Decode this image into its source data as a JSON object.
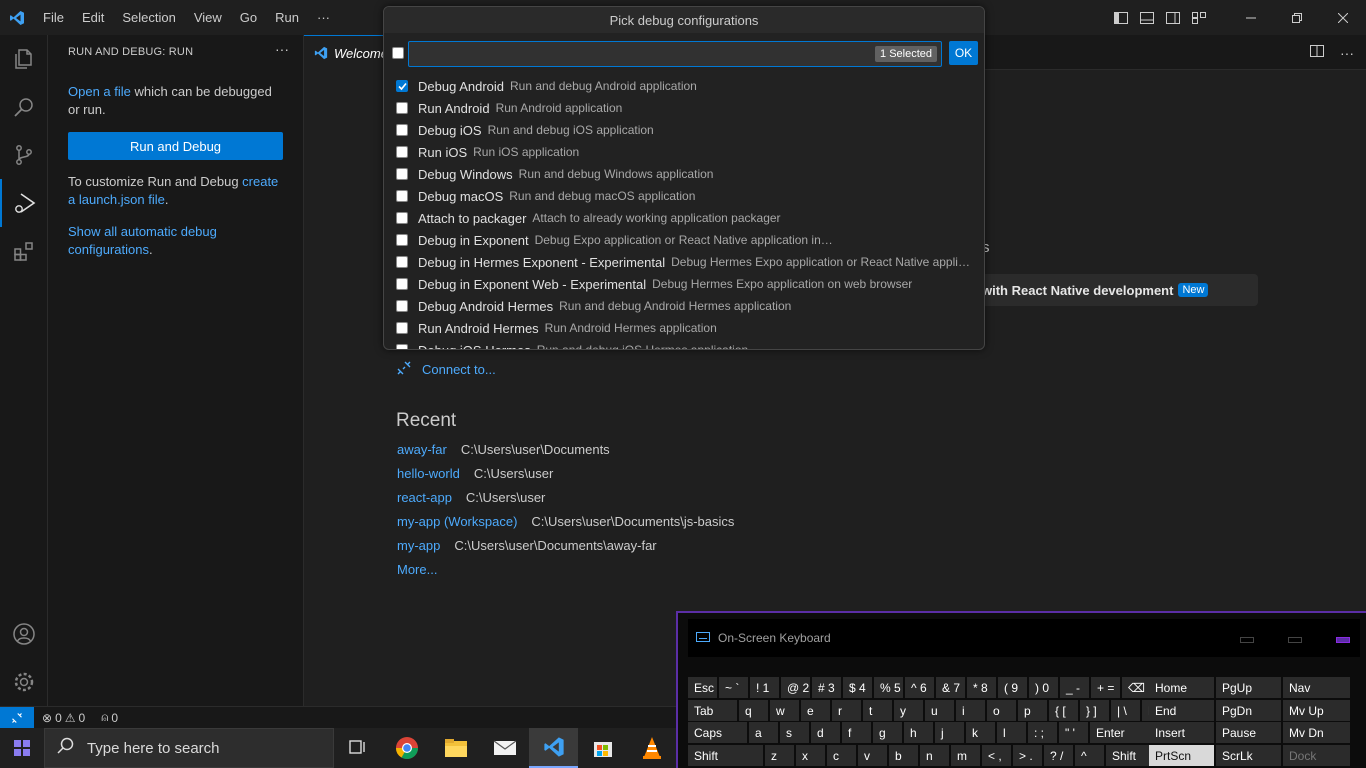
{
  "menubar": {
    "items": [
      "File",
      "Edit",
      "Selection",
      "View",
      "Go",
      "Run",
      "···"
    ]
  },
  "sidebar": {
    "title": "RUN AND DEBUG: RUN",
    "more": "···",
    "open_file_link": "Open a file",
    "open_file_rest": " which can be debugged or run.",
    "run_debug_button": "Run and Debug",
    "customize_text": "To customize Run and Debug ",
    "create_link": "create a launch.json file",
    "customize_end": ".",
    "show_all_link": "Show all automatic debug configurations",
    "show_all_end": "."
  },
  "editor": {
    "tab_label": "Welcome",
    "walkthrough_fragment": "s",
    "walkthrough_title": "with React Native development",
    "walkthrough_badge": "New",
    "connect_label": "Connect to...",
    "recent_heading": "Recent",
    "recent": [
      {
        "name": "away-far",
        "path": "C:\\Users\\user\\Documents"
      },
      {
        "name": "hello-world",
        "path": "C:\\Users\\user"
      },
      {
        "name": "react-app",
        "path": "C:\\Users\\user"
      },
      {
        "name": "my-app (Workspace)",
        "path": "C:\\Users\\user\\Documents\\js-basics"
      },
      {
        "name": "my-app",
        "path": "C:\\Users\\user\\Documents\\away-far"
      }
    ],
    "more_label": "More..."
  },
  "quickpick": {
    "title": "Pick debug configurations",
    "input_value": "",
    "selected_count": "1 Selected",
    "ok_label": "OK",
    "items": [
      {
        "label": "Debug Android",
        "desc": "Run and debug Android application",
        "checked": true
      },
      {
        "label": "Run Android",
        "desc": "Run Android application",
        "checked": false
      },
      {
        "label": "Debug iOS",
        "desc": "Run and debug iOS application",
        "checked": false
      },
      {
        "label": "Run iOS",
        "desc": "Run iOS application",
        "checked": false
      },
      {
        "label": "Debug Windows",
        "desc": "Run and debug Windows application",
        "checked": false
      },
      {
        "label": "Debug macOS",
        "desc": "Run and debug macOS application",
        "checked": false
      },
      {
        "label": "Attach to packager",
        "desc": "Attach to already working application packager",
        "checked": false
      },
      {
        "label": "Debug in Exponent",
        "desc": "Debug Expo application or React Native application in Expo",
        "checked": false
      },
      {
        "label": "Debug in Hermes Exponent - Experimental",
        "desc": "Debug Hermes Expo application or React Native applic...",
        "checked": false
      },
      {
        "label": "Debug in Exponent Web - Experimental",
        "desc": "Debug Hermes Expo application on web browser",
        "checked": false
      },
      {
        "label": "Debug Android Hermes",
        "desc": "Run and debug Android Hermes application",
        "checked": false
      },
      {
        "label": "Run Android Hermes",
        "desc": "Run Android Hermes application",
        "checked": false
      },
      {
        "label": "Debug iOS Hermes",
        "desc": "Run and debug iOS Hermes application",
        "checked": false
      }
    ]
  },
  "statusbar": {
    "errors": "0",
    "warnings": "0",
    "ports": "0"
  },
  "osk": {
    "title": "On-Screen Keyboard",
    "row1": [
      "Esc",
      "~ `",
      "! 1",
      "@ 2",
      "# 3",
      "$ 4",
      "% 5",
      "^ 6",
      "& 7",
      "* 8",
      "( 9",
      ") 0",
      "_ -",
      "+ =",
      "⌫",
      "Home",
      "PgUp",
      "Nav"
    ],
    "row2": [
      "Tab",
      "q",
      "w",
      "e",
      "r",
      "t",
      "y",
      "u",
      "i",
      "o",
      "p",
      "{ [",
      "} ]",
      "| \\",
      "Del",
      "End",
      "PgDn",
      "Mv Up"
    ],
    "row3": [
      "Caps",
      "a",
      "s",
      "d",
      "f",
      "g",
      "h",
      "j",
      "k",
      "l",
      ": ;",
      "\" '",
      "Enter",
      "Insert",
      "Pause",
      "Mv Dn"
    ],
    "row4": [
      "Shift",
      "z",
      "x",
      "c",
      "v",
      "b",
      "n",
      "m",
      "< ,",
      "> .",
      "? /",
      "^",
      "Shift",
      "PrtScn",
      "ScrLk",
      "Dock"
    ]
  },
  "taskbar": {
    "search_placeholder": "Type here to search"
  },
  "colors": {
    "accent": "#0078d4",
    "link": "#4daafc",
    "osk_border": "#5b2ea6"
  }
}
